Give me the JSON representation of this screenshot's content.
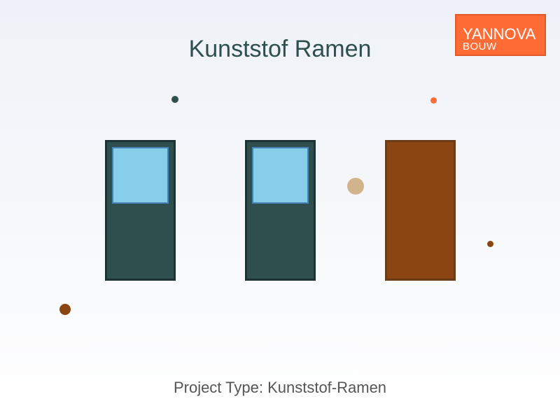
{
  "title": "Kunststof Ramen",
  "logo": {
    "name": "YANNOVA",
    "subtitle": "BOUW"
  },
  "footer": {
    "label": "Project Type:",
    "value": "Kunststof-Ramen"
  },
  "colors": {
    "title": "#2f4f4f",
    "logo_background": "#ff6b35",
    "window_frame": "#2f4f4f",
    "window_glass": "#87ceeb",
    "door": "#8b4513",
    "footer_text": "#555555"
  }
}
